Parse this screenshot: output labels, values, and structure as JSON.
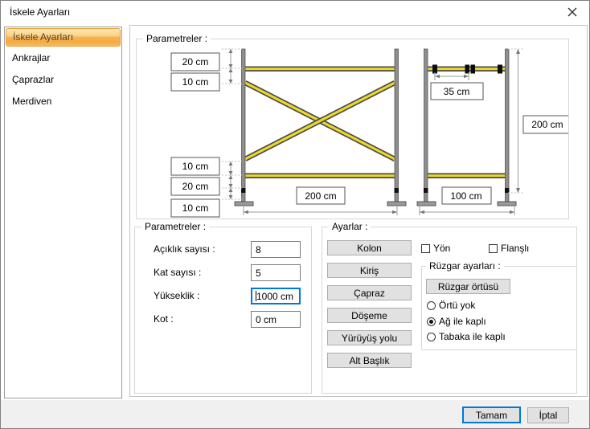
{
  "window": {
    "title": "İskele Ayarları"
  },
  "icons": {
    "close": "close-x"
  },
  "colors": {
    "accent_orange": "#f5ab44",
    "focus_blue": "#0078d7",
    "bar_yellow": "#ecd829",
    "button_face": "#e1e1e1"
  },
  "sidebar": {
    "items": [
      {
        "label": "İskele Ayarları",
        "selected": true
      },
      {
        "label": "Ankrajlar",
        "selected": false
      },
      {
        "label": "Çaprazlar",
        "selected": false
      },
      {
        "label": "Merdiven",
        "selected": false
      }
    ]
  },
  "drawing_group": {
    "title": "Parametreler :",
    "dims": {
      "top_20": "20 cm",
      "top_10": "10 cm",
      "bot_10a": "10 cm",
      "bot_20": "20 cm",
      "bot_10b": "10 cm",
      "span_width": "200 cm",
      "clamp_spacing": "35 cm",
      "frame_height": "200 cm",
      "frame_width": "100 cm"
    }
  },
  "params_group": {
    "title": "Parametreler :",
    "fields": [
      {
        "label": "Açıklık sayısı :",
        "value": "8",
        "focused": false
      },
      {
        "label": "Kat sayısı :",
        "value": "5",
        "focused": false
      },
      {
        "label": "Yükseklik :",
        "value": "1000 cm",
        "focused": true
      },
      {
        "label": "Kot :",
        "value": "0 cm",
        "focused": false
      }
    ]
  },
  "settings_group": {
    "title": "Ayarlar :",
    "buttons": [
      "Kolon",
      "Kiriş",
      "Çapraz",
      "Döşeme",
      "Yürüyüş yolu",
      "Alt Başlık"
    ],
    "checkboxes": [
      {
        "label": "Yön",
        "checked": false
      },
      {
        "label": "Flanşlı",
        "checked": false
      }
    ],
    "wind_group": {
      "title": "Rüzgar ayarları :",
      "button_label": "Rüzgar örtüsü",
      "radios": [
        {
          "label": "Örtü yok",
          "selected": false
        },
        {
          "label": "Ağ ile kaplı",
          "selected": true
        },
        {
          "label": "Tabaka ile kaplı",
          "selected": false
        }
      ]
    }
  },
  "footer": {
    "ok_label": "Tamam",
    "cancel_label": "İptal"
  }
}
